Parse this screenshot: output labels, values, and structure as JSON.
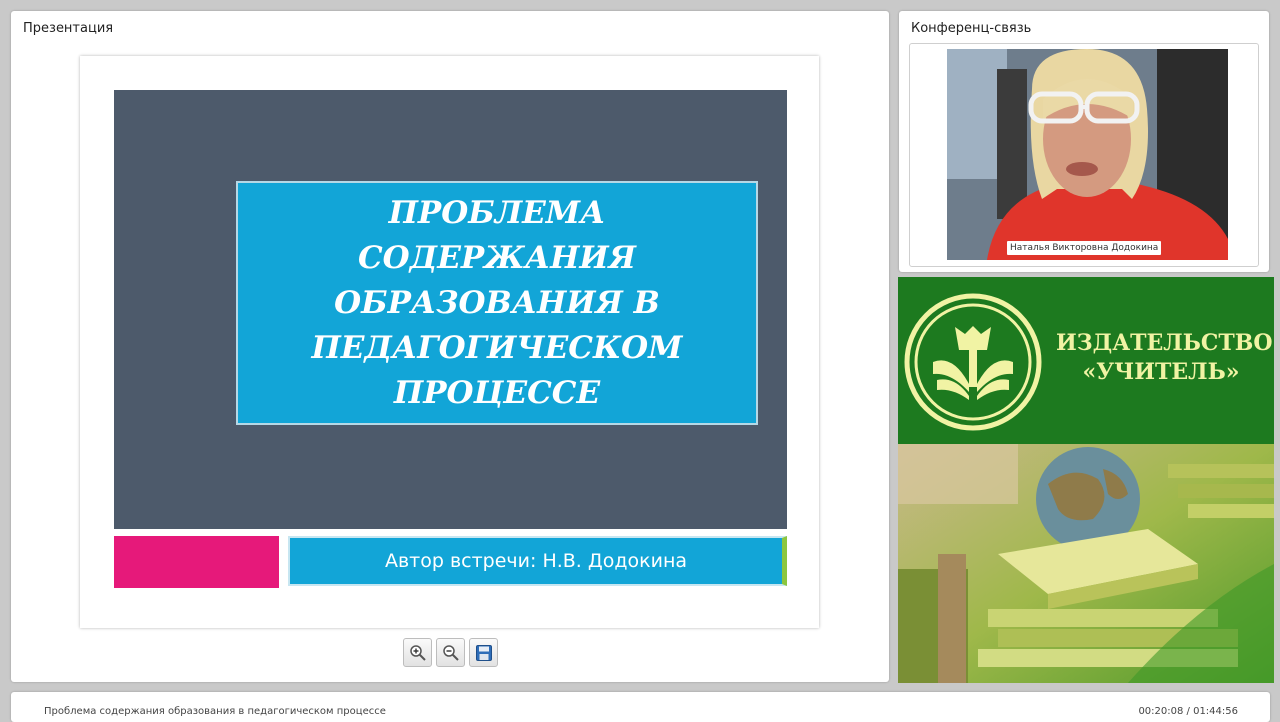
{
  "presentation_panel": {
    "title": "Презентация",
    "slide": {
      "title": "Проблема содержания образования в педагогическом процессе",
      "author": "Автор встречи: Н.В. Додокина"
    },
    "toolbar": {
      "zoom_in_icon": "zoom-in-icon",
      "zoom_out_icon": "zoom-out-icon",
      "save_icon": "save-icon"
    }
  },
  "conference_panel": {
    "title": "Конференц-связь",
    "participant_name": "Наталья Викторовна Додокина"
  },
  "banner": {
    "publisher_line1": "ИЗДАТЕЛЬСТВО",
    "publisher_line2": "«УЧИТЕЛЬ»",
    "logo_icon": "book-torch-logo-icon"
  },
  "footer": {
    "lecture_title": "Проблема содержания образования в педагогическом процессе",
    "time": "00:20:08 / 01:44:56"
  },
  "colors": {
    "slide_background": "#4d5a6b",
    "slide_accent_blue": "#12a5d7",
    "slide_accent_pink": "#e6197a",
    "banner_green": "#1d7a1f"
  }
}
